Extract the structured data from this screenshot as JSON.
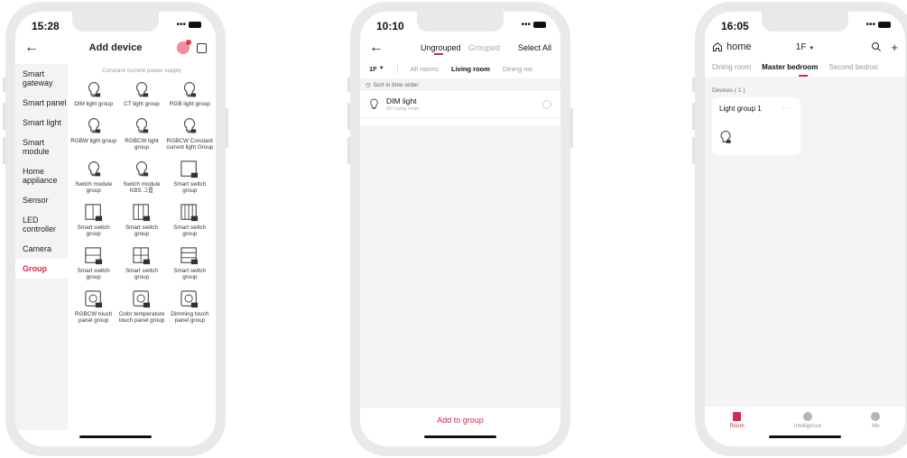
{
  "phone1": {
    "time": "15:28",
    "title": "Add device",
    "categories": [
      {
        "label": "Smart gateway",
        "active": false
      },
      {
        "label": "Smart panel",
        "active": false
      },
      {
        "label": "Smart light",
        "active": false
      },
      {
        "label": "Smart module",
        "active": false
      },
      {
        "label": "Home appliance",
        "active": false
      },
      {
        "label": "Sensor",
        "active": false
      },
      {
        "label": "LED controller",
        "active": false
      },
      {
        "label": "Camera",
        "active": false
      },
      {
        "label": "Group",
        "active": true
      }
    ],
    "section_title": "Constant current power supply",
    "items": [
      {
        "label": "DIM light group",
        "icon": "bulb-icon"
      },
      {
        "label": "CT light group",
        "icon": "bulb-icon"
      },
      {
        "label": "RGB light group",
        "icon": "bulb-icon"
      },
      {
        "label": "RGBW light group",
        "icon": "bulb-icon"
      },
      {
        "label": "RGBCW light group",
        "icon": "bulb-icon"
      },
      {
        "label": "RGBCW Constant current light Group",
        "icon": "bulb-icon"
      },
      {
        "label": "Switch module group",
        "icon": "bulb-icon"
      },
      {
        "label": "Switch module KBS 그룹",
        "icon": "bulb-icon"
      },
      {
        "label": "Smart switch group",
        "icon": "switch-1gang-icon"
      },
      {
        "label": "Smart switch group",
        "icon": "switch-2gang-icon"
      },
      {
        "label": "Smart switch group",
        "icon": "switch-3gang-icon"
      },
      {
        "label": "Smart switch group",
        "icon": "switch-4gang-icon"
      },
      {
        "label": "Smart switch group",
        "icon": "switch-row2-icon"
      },
      {
        "label": "Smart switch group",
        "icon": "switch-grid-icon"
      },
      {
        "label": "Smart switch group",
        "icon": "switch-bar-icon"
      },
      {
        "label": "RGBCW touch panel group",
        "icon": "touch-panel-icon"
      },
      {
        "label": "Color temperature touch panel group",
        "icon": "touch-panel-icon"
      },
      {
        "label": "Dimming touch panel group",
        "icon": "touch-panel-icon"
      }
    ]
  },
  "phone2": {
    "time": "10:10",
    "tabs": {
      "ungrouped": "Ungrouped",
      "grouped": "Grouped"
    },
    "select_all": "Select All",
    "floor": "1F",
    "rooms": [
      {
        "label": "All rooms",
        "active": false
      },
      {
        "label": "Living room",
        "active": true
      },
      {
        "label": "Dining roc",
        "active": false
      }
    ],
    "sort_label": "Sort in time order",
    "device": {
      "name": "DIM light",
      "location": "1F Living room"
    },
    "add_button": "Add to group"
  },
  "phone3": {
    "time": "16:05",
    "home": "home",
    "floor": "1F",
    "rooms": [
      {
        "label": "Dining room",
        "active": false
      },
      {
        "label": "Master bedroom",
        "active": true
      },
      {
        "label": "Second bedroo",
        "active": false
      }
    ],
    "devices_label": "Devices ( 1 )",
    "card": {
      "name": "Light group 1",
      "more": "···"
    },
    "nav": [
      {
        "label": "Room",
        "active": true,
        "icon": "room-icon"
      },
      {
        "label": "Intelligence",
        "active": false,
        "icon": "intelligence-icon"
      },
      {
        "label": "Me",
        "active": false,
        "icon": "me-icon"
      }
    ]
  },
  "colors": {
    "accent": "#d9284b",
    "phone_frame": "#e9e9e9",
    "muted": "#999999"
  }
}
